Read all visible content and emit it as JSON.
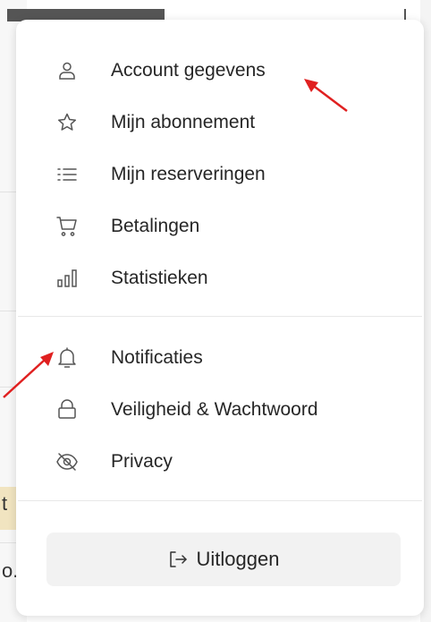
{
  "background": {
    "partial_text_yellow": "t",
    "partial_text_bottom": "o."
  },
  "menu": {
    "items": [
      {
        "label": "Account gegevens",
        "icon": "user-icon"
      },
      {
        "label": "Mijn abonnement",
        "icon": "star-icon"
      },
      {
        "label": "Mijn reserveringen",
        "icon": "list-icon"
      },
      {
        "label": "Betalingen",
        "icon": "cart-icon"
      },
      {
        "label": "Statistieken",
        "icon": "bar-chart-icon"
      },
      {
        "label": "Notificaties",
        "icon": "bell-icon"
      },
      {
        "label": "Veiligheid & Wachtwoord",
        "icon": "lock-icon"
      },
      {
        "label": "Privacy",
        "icon": "eye-off-icon"
      }
    ],
    "logout": {
      "label": "Uitloggen",
      "icon": "logout-icon"
    }
  },
  "colors": {
    "annotation_arrow": "#e02020",
    "icon_stroke": "#555555",
    "logout_bg": "#f2f2f2"
  }
}
